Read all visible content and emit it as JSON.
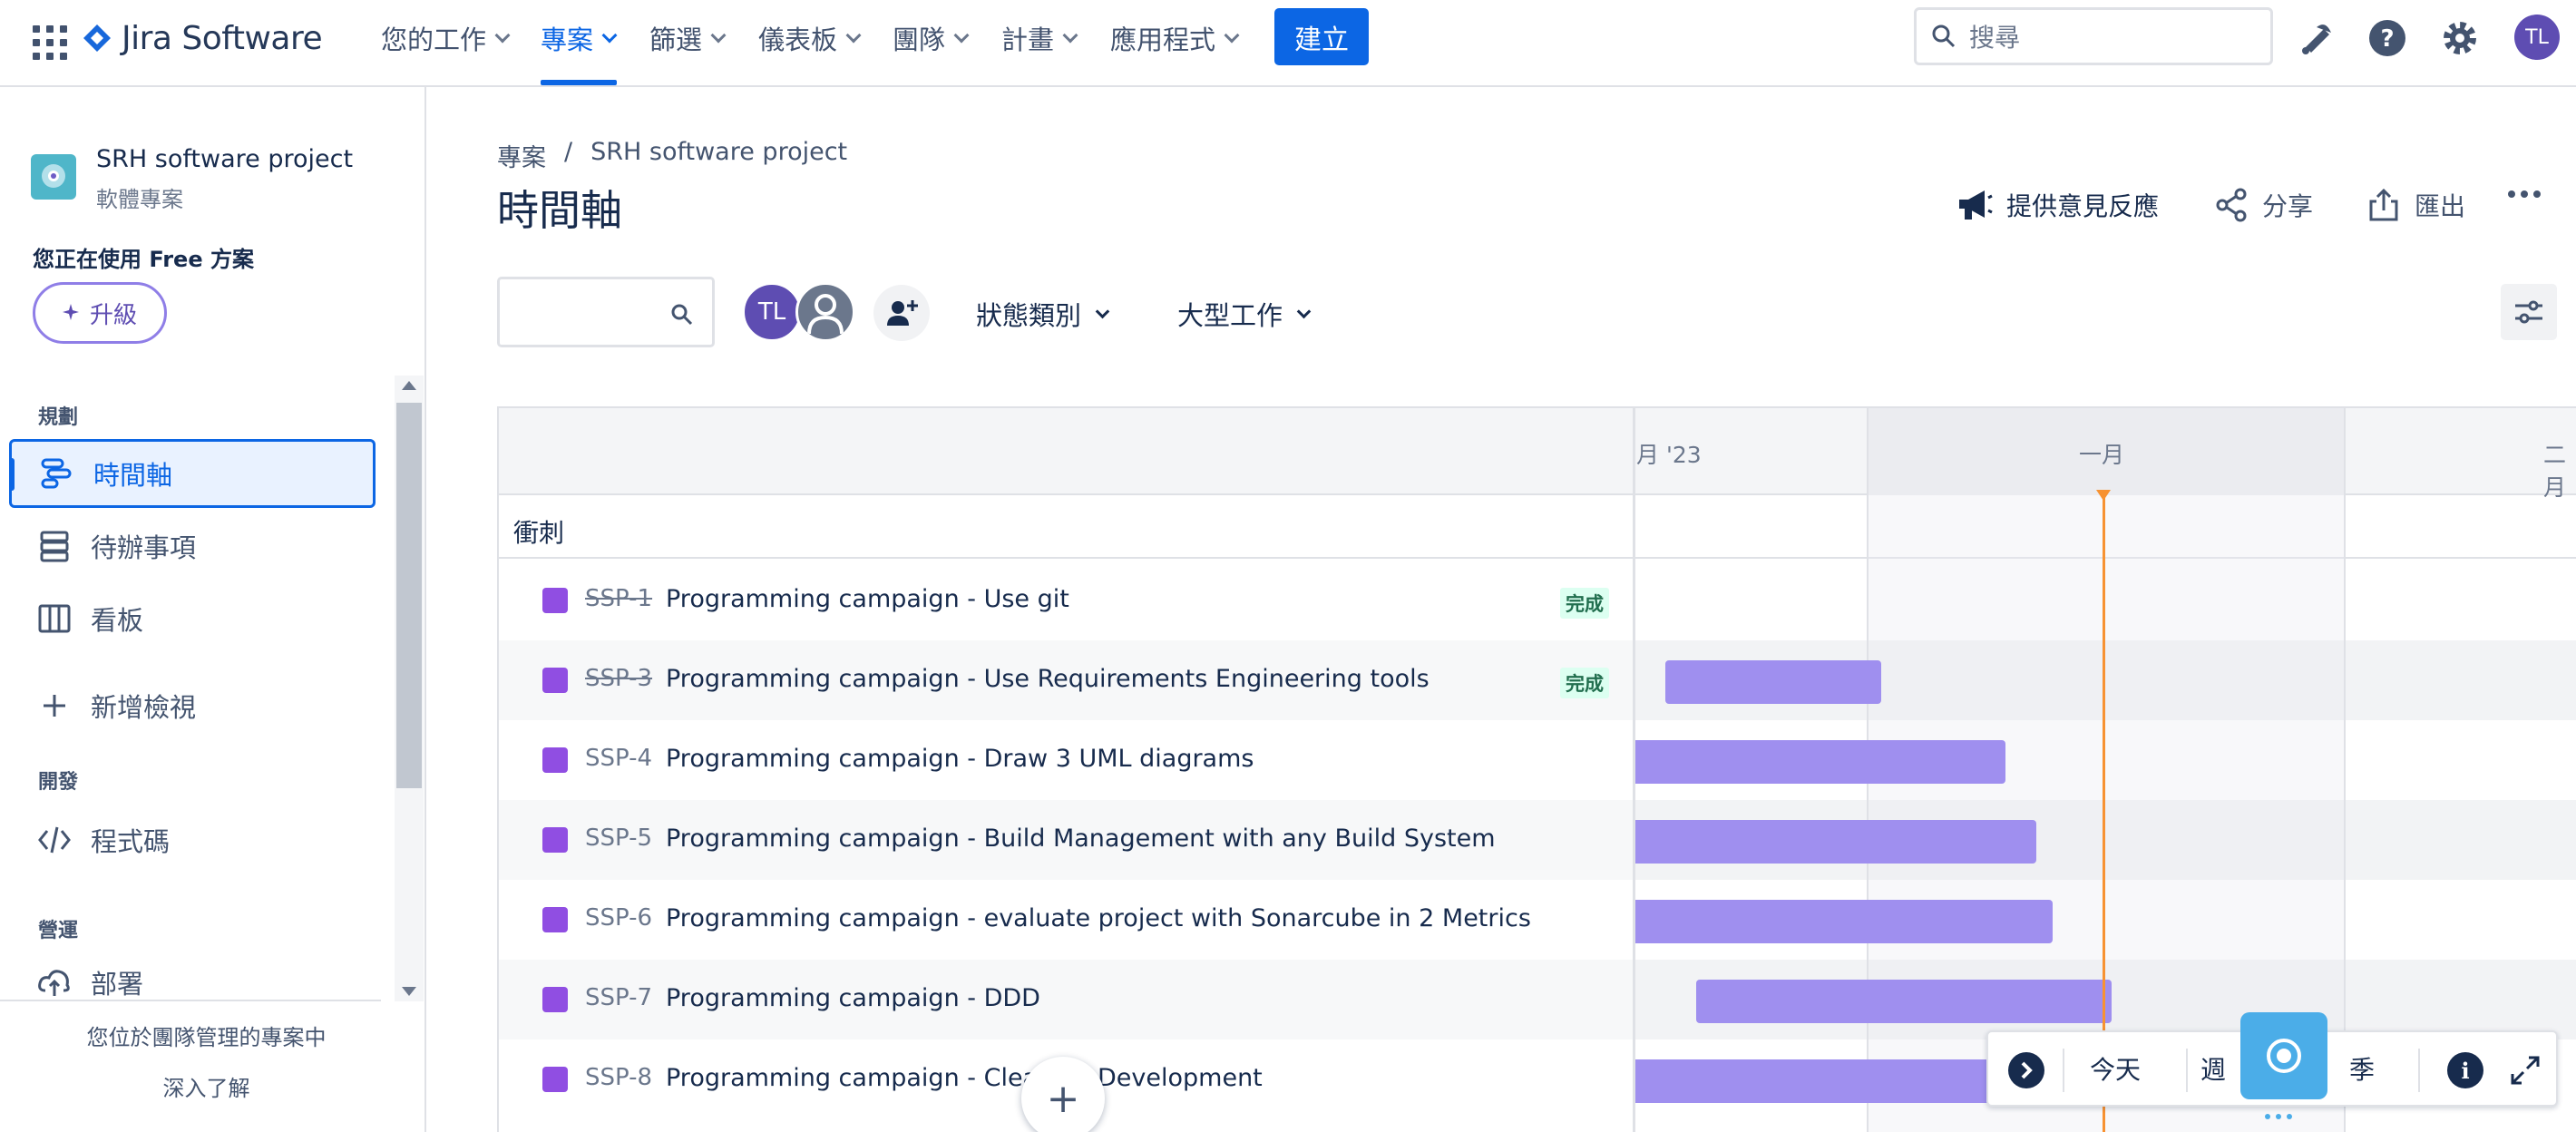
{
  "topnav": {
    "product": "Jira Software",
    "items": [
      {
        "label": "您的工作"
      },
      {
        "label": "專案"
      },
      {
        "label": "篩選"
      },
      {
        "label": "儀表板"
      },
      {
        "label": "團隊"
      },
      {
        "label": "計畫"
      },
      {
        "label": "應用程式"
      }
    ],
    "create_label": "建立",
    "search_placeholder": "搜尋",
    "user_initials": "TL"
  },
  "sidebar": {
    "project_name": "SRH software project",
    "project_type": "軟體專案",
    "plan_text": "您正在使用 Free 方案",
    "upgrade_label": "升級",
    "section_planning": "規劃",
    "items": [
      {
        "label": "時間軸"
      },
      {
        "label": "待辦事項"
      },
      {
        "label": "看板"
      },
      {
        "label": "新增檢視"
      }
    ],
    "section_dev": "開發",
    "code_label": "程式碼",
    "section_ops": "營運",
    "deploy_label": "部署",
    "footer_text": "您位於團隊管理的專案中",
    "footer_link": "深入了解"
  },
  "header": {
    "breadcrumb_root": "專案",
    "breadcrumb_sep": "/",
    "breadcrumb_project": "SRH software project",
    "title": "時間軸",
    "feedback_label": "提供意見反應",
    "share_label": "分享",
    "export_label": "匯出"
  },
  "filters": {
    "avatar_initials": "TL",
    "status_category": "狀態類別",
    "epic": "大型工作"
  },
  "timeline": {
    "months": [
      "月 '23",
      "一月",
      "二月"
    ],
    "sprint_label": "衝刺",
    "issues": [
      {
        "key": "SSP-1",
        "summary": "Programming campaign - Use git",
        "status": "完成",
        "done": true
      },
      {
        "key": "SSP-3",
        "summary": "Programming campaign - Use Requirements Engineering tools",
        "status": "完成",
        "done": true
      },
      {
        "key": "SSP-4",
        "summary": "Programming campaign - Draw 3 UML diagrams",
        "done": false
      },
      {
        "key": "SSP-5",
        "summary": "Programming campaign - Build Management with any Build System",
        "done": false
      },
      {
        "key": "SSP-6",
        "summary": "Programming campaign - evaluate project with Sonarcube in 2 Metrics",
        "done": false
      },
      {
        "key": "SSP-7",
        "summary": "Programming campaign - DDD",
        "done": false
      },
      {
        "key": "SSP-8",
        "summary": "Programming campaign - Clean",
        "summary_tail": "Development",
        "done": false
      }
    ]
  },
  "controls": {
    "today": "今天",
    "week": "週",
    "quarter": "季",
    "info": "i"
  },
  "colors": {
    "brand_blue": "#0c66e4",
    "bar_purple": "#9f8fef",
    "today_line": "#f79232",
    "story_icon": "#904ee2",
    "avatar_purple": "#5e4db2"
  }
}
